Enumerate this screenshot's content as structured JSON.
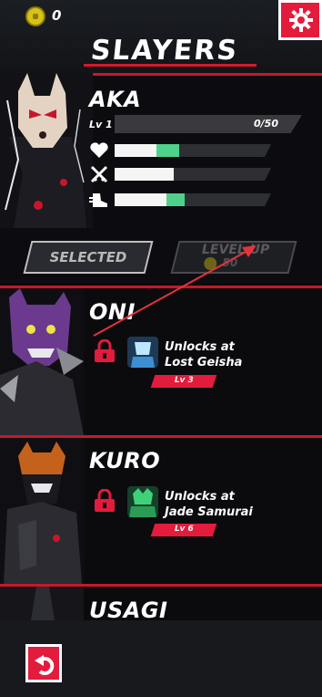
{
  "header": {
    "coins": "0",
    "title": "SLAYERS",
    "settings_icon": "gear-icon"
  },
  "slayers": [
    {
      "name": "AKA",
      "level_label": "Lv 1",
      "xp": "0/50",
      "stats": [
        {
          "icon": "heart-icon",
          "white": 0.27,
          "green": 0.14
        },
        {
          "icon": "swords-icon",
          "white": 0.38,
          "green": 0
        },
        {
          "icon": "speed-shoe-icon",
          "white": 0.33,
          "green": 0.12
        }
      ],
      "selected_label": "SELECTED",
      "level_up_label": "LEVEL UP",
      "level_up_cost": "50"
    },
    {
      "name": "ONI",
      "unlock_line1": "Unlocks at",
      "unlock_line2": "Lost Geisha",
      "unlock_level": "Lv 3"
    },
    {
      "name": "KURO",
      "unlock_line1": "Unlocks at",
      "unlock_line2": "Jade Samurai",
      "unlock_level": "Lv 6"
    },
    {
      "name": "USAGI"
    }
  ],
  "footer": {
    "back_icon": "back-arrow-icon"
  },
  "colors": {
    "accent": "#e31b3d",
    "stat_green": "#4fd18b",
    "coin": "#d8c21a"
  }
}
